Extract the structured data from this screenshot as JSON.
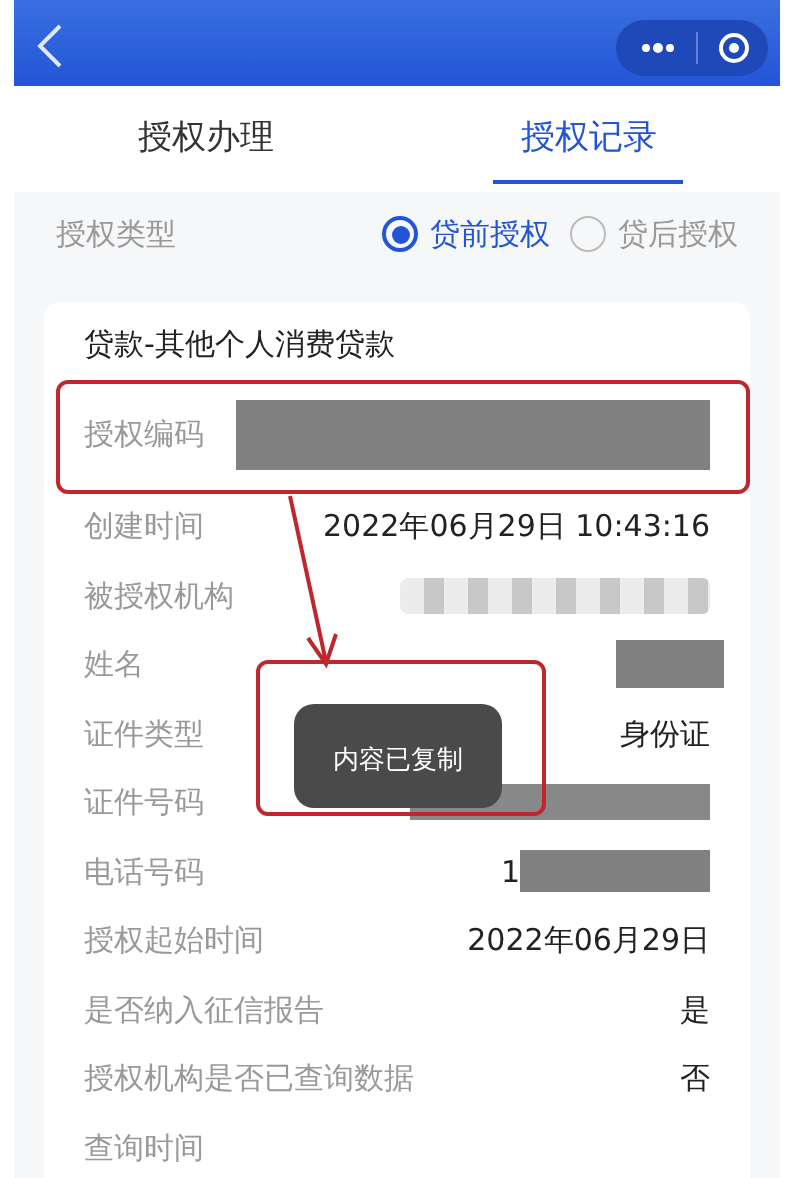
{
  "tabs": [
    {
      "label": "授权办理",
      "selected": false
    },
    {
      "label": "授权记录",
      "selected": true
    }
  ],
  "auth_type": {
    "label": "授权类型",
    "options": [
      {
        "label": "贷前授权",
        "selected": true
      },
      {
        "label": "贷后授权",
        "selected": false
      }
    ]
  },
  "record": {
    "title": "贷款-其他个人消费贷款",
    "rows": [
      {
        "label": "授权编码",
        "kind": "redacted"
      },
      {
        "label": "创建时间",
        "kind": "text",
        "value": "2022年06月29日 10:43:16"
      },
      {
        "label": "被授权机构",
        "kind": "blurred"
      },
      {
        "label": "姓名",
        "kind": "redacted"
      },
      {
        "label": "证件类型",
        "kind": "text",
        "value": "身份证"
      },
      {
        "label": "证件号码",
        "kind": "redacted"
      },
      {
        "label": "电话号码",
        "kind": "partial",
        "value": "1"
      },
      {
        "label": "授权起始时间",
        "kind": "text",
        "value": "2022年06月29日"
      },
      {
        "label": "是否纳入征信报告",
        "kind": "text",
        "value": "是"
      },
      {
        "label": "授权机构是否已查询数据",
        "kind": "text",
        "value": "否"
      },
      {
        "label": "查询时间",
        "kind": "empty"
      }
    ]
  },
  "toast": {
    "text": "内容已复制"
  }
}
